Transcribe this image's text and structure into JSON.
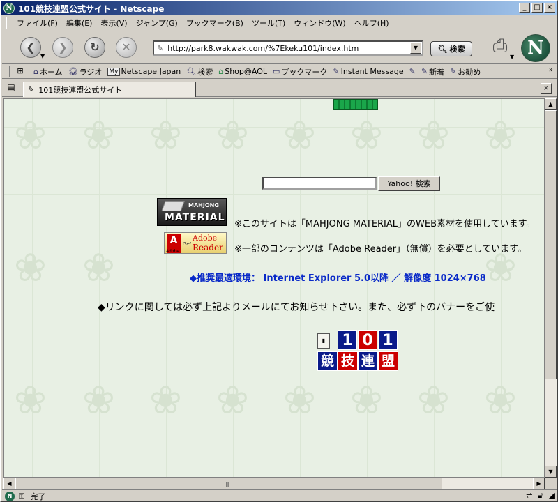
{
  "window": {
    "title": "101競技連盟公式サイト - Netscape",
    "app_icon_letter": "N",
    "buttons": [
      "_",
      "□",
      "×"
    ]
  },
  "menu": [
    "ファイル(F)",
    "編集(E)",
    "表示(V)",
    "ジャンプ(G)",
    "ブックマーク(B)",
    "ツール(T)",
    "ウィンドウ(W)",
    "ヘルプ(H)"
  ],
  "nav": {
    "back_icon": "back-arrow-icon",
    "url": "http://park8.wakwak.com/%7Ekeku101/index.htm",
    "search_label": "検索",
    "logo_letter": "N"
  },
  "personal_toolbar": {
    "items": [
      {
        "label": "ホーム",
        "icon": "home-icon"
      },
      {
        "label": "ラジオ",
        "icon": "headphones-icon"
      },
      {
        "label": "Netscape Japan",
        "icon": "my-icon",
        "badge": "My"
      },
      {
        "label": "検索",
        "icon": "search-icon"
      },
      {
        "label": "Shop@AOL",
        "icon": "shop-icon"
      },
      {
        "label": "ブックマーク",
        "icon": "folder-icon"
      },
      {
        "label": "Instant Message",
        "icon": "bookmark-icon"
      },
      {
        "label": "",
        "icon": "bookmark-icon"
      },
      {
        "label": "新着",
        "icon": "bookmark-icon"
      },
      {
        "label": "お勧め",
        "icon": "bookmark-icon"
      }
    ],
    "more": "»"
  },
  "tab": {
    "title": "101競技連盟公式サイト",
    "close": "×"
  },
  "page": {
    "yahoo_button": "Yahoo! 検索",
    "search_value": "",
    "mahjong_logo_top": "MAHJONG",
    "mahjong_logo_bottom": "MATERIAL",
    "notice_mahjong": "※このサイトは「MAHJONG MATERIAL」のWEB素材を使用しています。",
    "adobe_get": "Get",
    "adobe_word": "Adobe",
    "adobe_reader": "Reader",
    "adobe_small": "Adobe",
    "notice_adobe": "※一部のコンテンツは「Adobe Reader」（無償）を必要としています。",
    "recommend": "◆推奨最適環境： Internet Explorer 5.0以降 ／ 解像度 1024×768",
    "link_notice": "◆リンクに関しては必ず上記よりメールにてお知らせ下さい。また、必ず下のバナーをご使",
    "banner_numbers": [
      "1",
      "0",
      "1"
    ],
    "banner_kanji": [
      "競",
      "技",
      "連",
      "盟"
    ]
  },
  "status": {
    "text": "完了"
  }
}
